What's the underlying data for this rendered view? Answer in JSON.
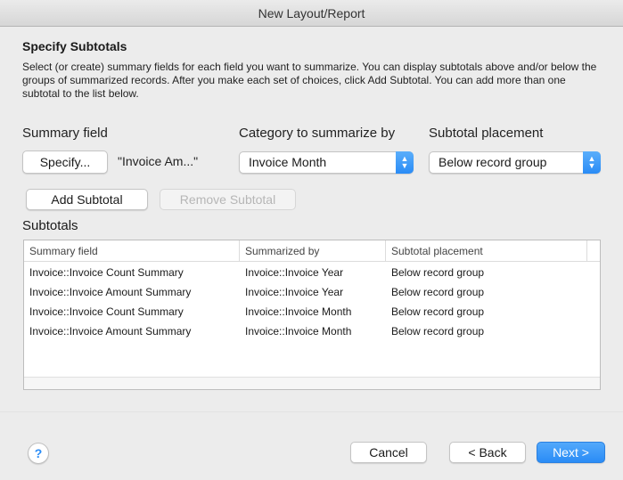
{
  "window": {
    "title": "New Layout/Report"
  },
  "section": {
    "heading": "Specify Subtotals",
    "description": "Select (or create) summary fields for each field you want to summarize. You can display subtotals above and/or below the groups of summarized records. After you make each set of choices, click Add Subtotal. You can add more than one subtotal to the list below."
  },
  "summary": {
    "label": "Summary field",
    "specify_button": "Specify...",
    "value": "\"Invoice Am...\""
  },
  "category": {
    "label": "Category to summarize by",
    "selected": "Invoice Month"
  },
  "placement": {
    "label": "Subtotal placement",
    "selected": "Below record group"
  },
  "actions": {
    "add_subtotal": "Add Subtotal",
    "remove_subtotal": "Remove Subtotal"
  },
  "subtotals": {
    "label": "Subtotals",
    "columns": [
      "Summary field",
      "Summarized by",
      "Subtotal placement"
    ],
    "rows": [
      [
        "Invoice::Invoice Count Summary",
        "Invoice::Invoice Year",
        "Below record group"
      ],
      [
        "Invoice::Invoice Amount Summary",
        "Invoice::Invoice Year",
        "Below record group"
      ],
      [
        "Invoice::Invoice Count Summary",
        "Invoice::Invoice Month",
        "Below record group"
      ],
      [
        "Invoice::Invoice Amount Summary",
        "Invoice::Invoice Month",
        "Below record group"
      ]
    ]
  },
  "footer": {
    "help": "?",
    "cancel": "Cancel",
    "back": "< Back",
    "next": "Next >"
  },
  "colors": {
    "accent": "#2a8cf6",
    "window_bg": "#ececec"
  }
}
